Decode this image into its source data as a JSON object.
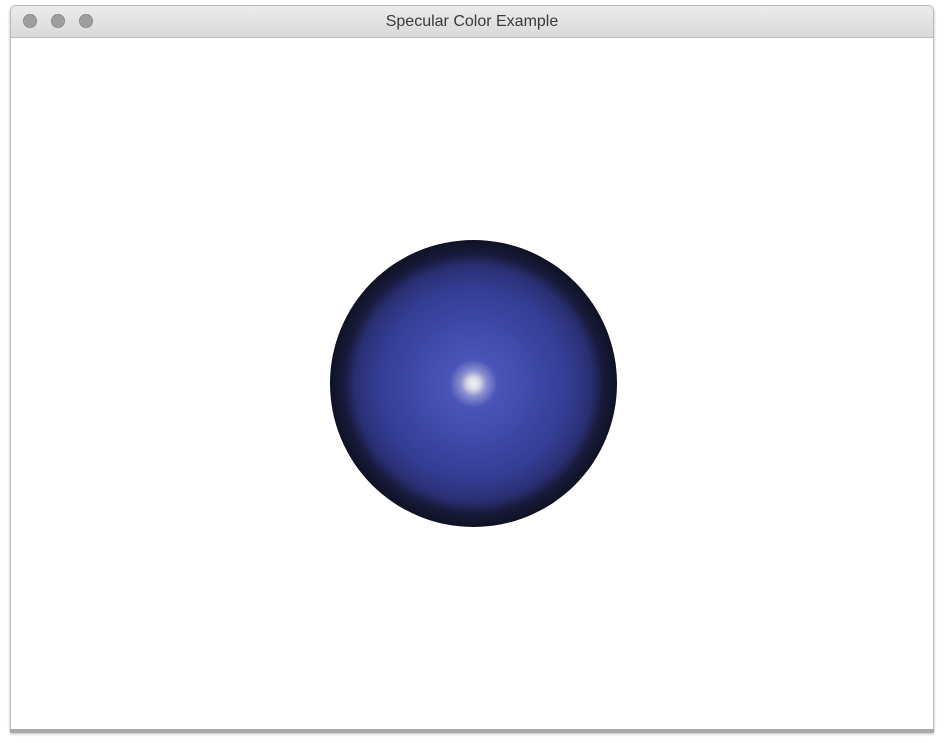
{
  "window": {
    "title": "Specular Color Example"
  },
  "icons": {
    "close": "close-icon",
    "minimize": "minimize-icon",
    "zoom": "zoom-icon"
  },
  "scene": {
    "object": "sphere",
    "diffuse_color": "#3e49a8",
    "specular_color": "#f2f2f2",
    "background": "#ffffff"
  }
}
